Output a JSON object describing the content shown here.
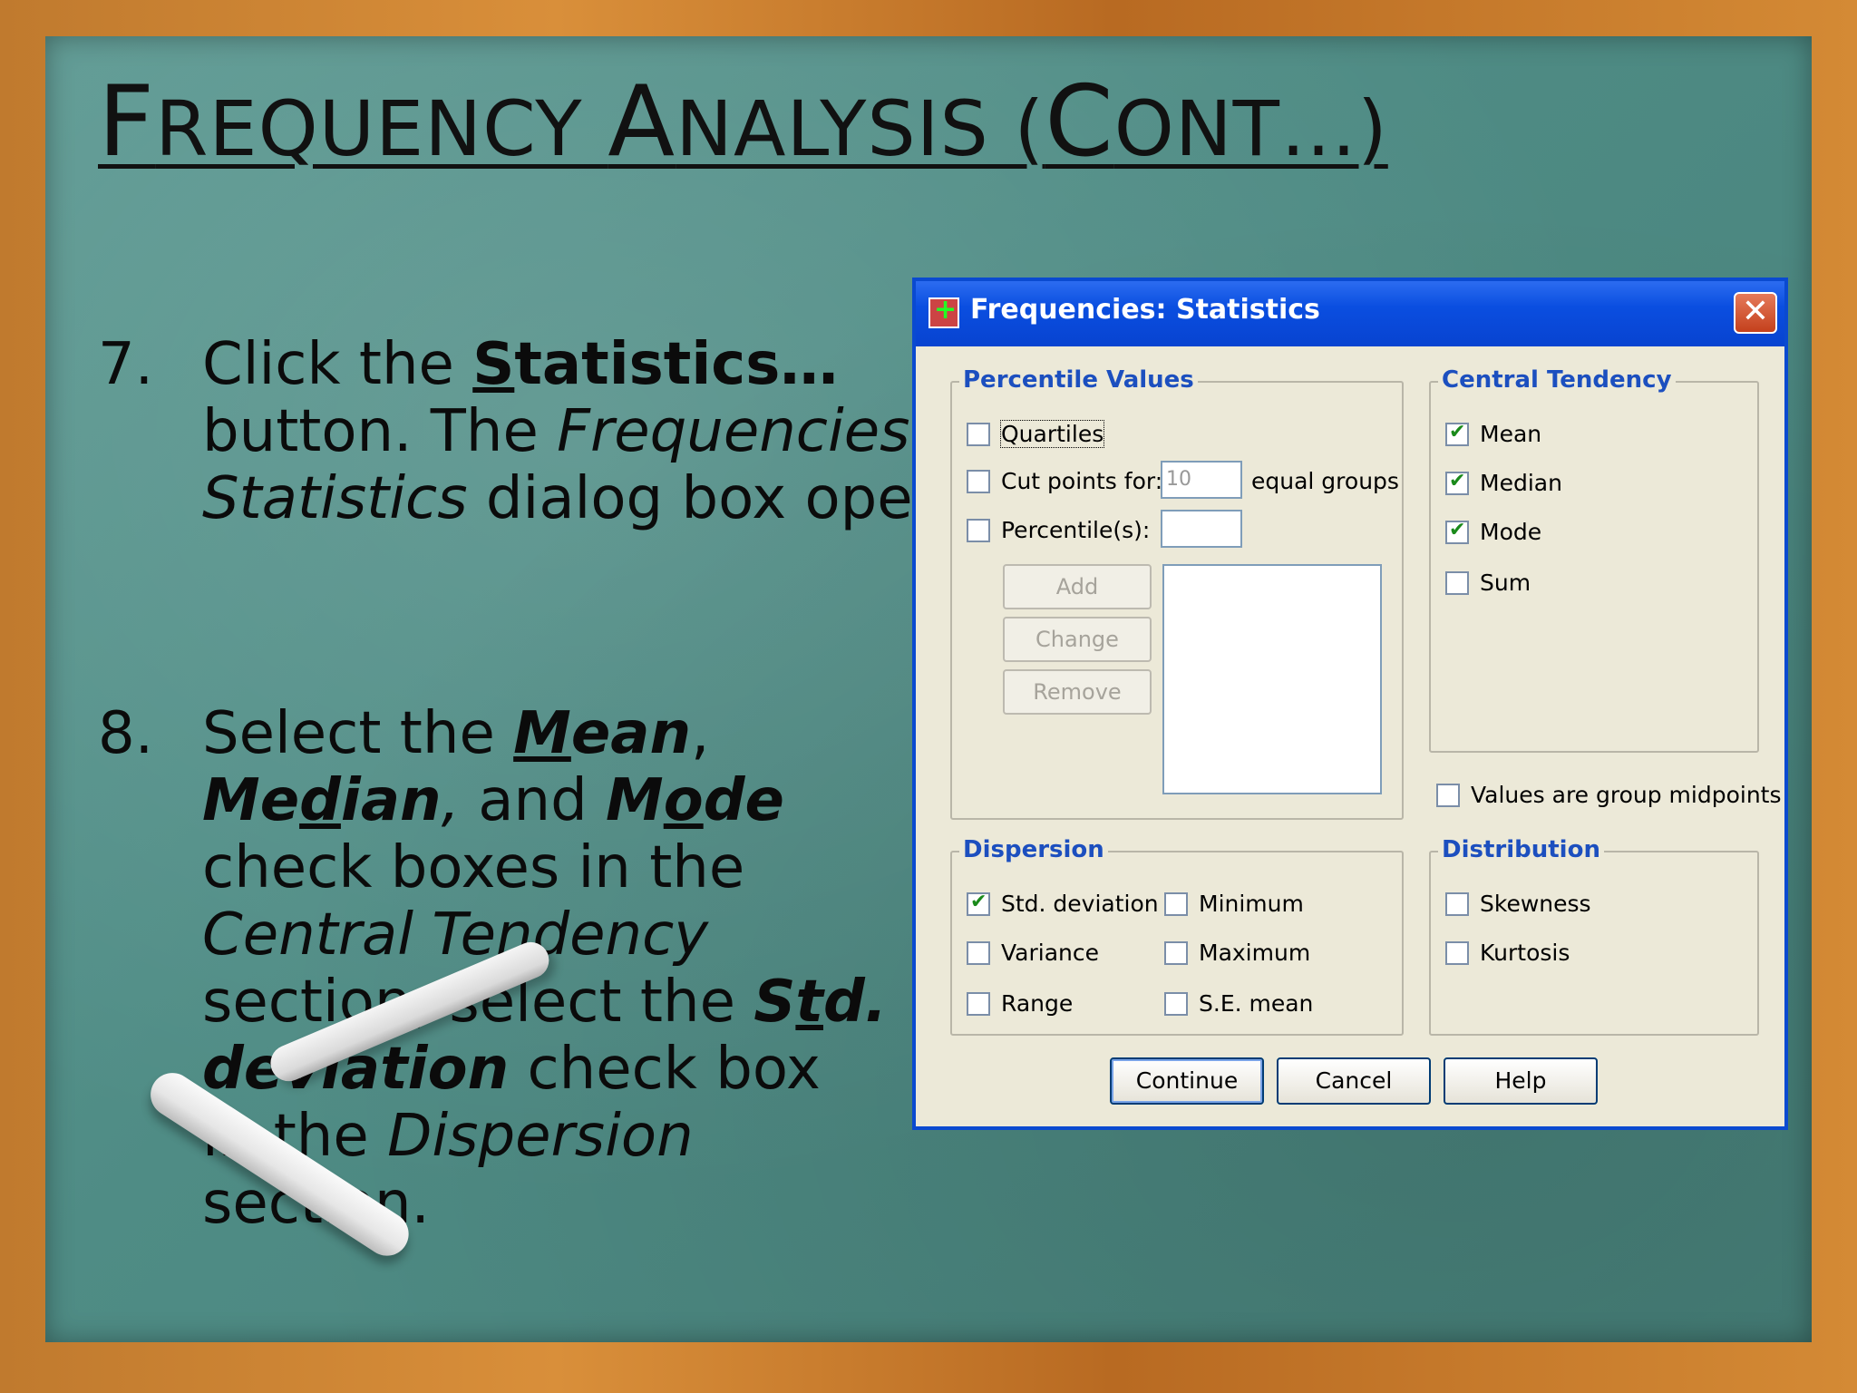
{
  "slide": {
    "title_parts": [
      "F",
      "REQUENCY ",
      "A",
      "NALYSIS (",
      "C",
      "ONT…)"
    ],
    "step7": {
      "number": "7.",
      "t1": "Click the ",
      "b_first": "S",
      "b_rest": "tatistics…",
      "t2": " button. The ",
      "i1": "Frequencies: Statistics",
      "t3": " dialog box opens."
    },
    "step8": {
      "number": "8.",
      "t1": "Select the ",
      "mean_m": "M",
      "mean_rest": "ean",
      "c1": ", ",
      "median_a": "Me",
      "median_d": "d",
      "median_b": "ian",
      "c2": ", ",
      "t_and": "and ",
      "mode_a": "M",
      "mode_o": "o",
      "mode_b": "de",
      "t2": " check boxes in the ",
      "i_ct": "Central Tendency",
      "t3": " section; select the ",
      "std_a": "S",
      "std_t": "t",
      "std_b": "d. deviation",
      "t4": " check box in the ",
      "i_disp": "Dispersion",
      "t5": " section."
    }
  },
  "dialog": {
    "title": "Frequencies: Statistics",
    "close_glyph": "✕",
    "percentile": {
      "label": "Percentile Values",
      "quartiles": "Quartiles",
      "cut_points": "Cut points for:",
      "cut_value": "10",
      "equal_groups": "equal groups",
      "percentiles": "Percentile(s):",
      "add": "Add",
      "change": "Change",
      "remove": "Remove"
    },
    "central": {
      "label": "Central Tendency",
      "mean": "Mean",
      "median": "Median",
      "mode": "Mode",
      "sum": "Sum"
    },
    "midpoints": "Values are group midpoints",
    "dispersion": {
      "label": "Dispersion",
      "std": "Std. deviation",
      "variance": "Variance",
      "range": "Range",
      "minimum": "Minimum",
      "maximum": "Maximum",
      "se_mean": "S.E. mean"
    },
    "distribution": {
      "label": "Distribution",
      "skewness": "Skewness",
      "kurtosis": "Kurtosis"
    },
    "buttons": {
      "continue": "Continue",
      "cancel": "Cancel",
      "help": "Help"
    }
  }
}
